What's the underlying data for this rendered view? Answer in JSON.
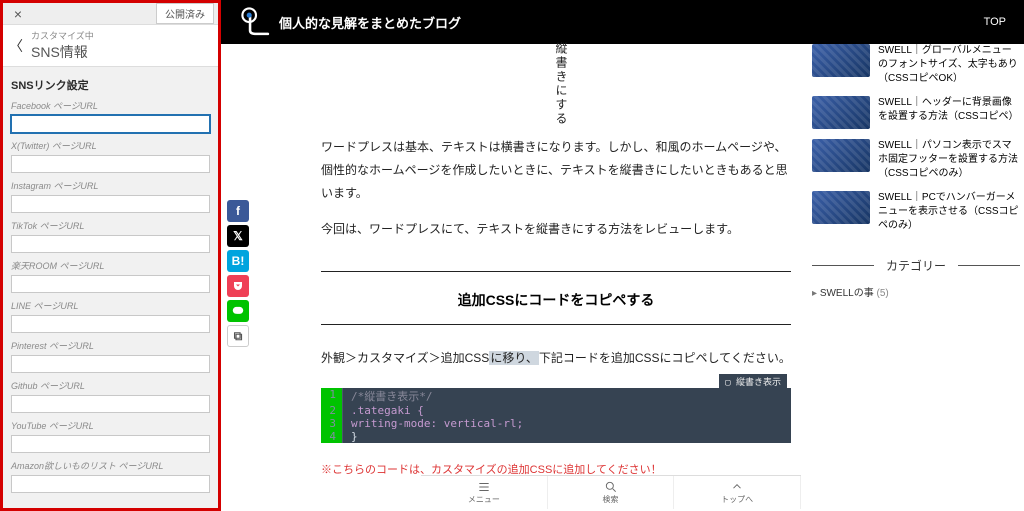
{
  "customizer": {
    "close": "×",
    "published": "公開済み",
    "breadcrumb_sub": "カスタマイズ中",
    "title": "SNS情報",
    "section": "SNSリンク設定",
    "fields": [
      {
        "label": "Facebook ページURL",
        "value": "",
        "active": true
      },
      {
        "label": "X(Twitter) ページURL",
        "value": ""
      },
      {
        "label": "Instagram ページURL",
        "value": ""
      },
      {
        "label": "TikTok ページURL",
        "value": ""
      },
      {
        "label": "楽天ROOM ページURL",
        "value": ""
      },
      {
        "label": "LINE ページURL",
        "value": ""
      },
      {
        "label": "Pinterest ページURL",
        "value": ""
      },
      {
        "label": "Github ページURL",
        "value": ""
      },
      {
        "label": "YouTube ページURL",
        "value": ""
      },
      {
        "label": "Amazon欲しいものリスト ページURL",
        "value": ""
      }
    ]
  },
  "header": {
    "site_name": "個人的な見解をまとめたブログ",
    "nav_top": "TOP"
  },
  "share_icons": {
    "fb": "f",
    "tw": "𝕏",
    "hb": "B!",
    "pk": "⯑",
    "ln": "LINE",
    "cp": "⧉"
  },
  "article": {
    "tategaki_sample": "縦書きにする",
    "p1": "ワードプレスは基本、テキストは横書きになります。しかし、和風のホームページや、個性的なホームページを作成したいときに、テキストを縦書きにしたいときもあると思います。",
    "p2": "今回は、ワードプレスにて、テキストを縦書きにする方法をレビューします。",
    "h2": "追加CSSにコードをコピペする",
    "path_pre": "外観＞カスタマイズ＞追加CSS",
    "path_hl": "に移り、",
    "path_post": "下記コードを追加CSSにコピペしてください。",
    "code_tag": "▢ 縦書き表示",
    "code": [
      {
        "n": "1",
        "kw": "",
        "txt": "/*縦書き表示*/",
        "cls": "cm"
      },
      {
        "n": "2",
        "kw": ".tategaki",
        "txt": " {",
        "cls": "kw"
      },
      {
        "n": "3",
        "kw": "writing-mode",
        "txt": ": vertical-rl;",
        "cls": "kw"
      },
      {
        "n": "4",
        "kw": "",
        "txt": "}",
        "cls": ""
      }
    ],
    "warning": "※こちらのコードは、カスタマイズの追加CSSに追加してください！"
  },
  "sidebar": {
    "cards": [
      {
        "t": "SWELL｜グローバルメニューのフォントサイズ、太字もあり（CSSコピペOK）"
      },
      {
        "t": "SWELL｜ヘッダーに背景画像を設置する方法（CSSコピペ）"
      },
      {
        "t": "SWELL｜パソコン表示でスマホ固定フッターを設置する方法（CSSコピペのみ）"
      },
      {
        "t": "SWELL｜PCでハンバーガーメニューを表示させる（CSSコピペのみ）"
      }
    ],
    "cat_heading": "カテゴリー",
    "cat_item": "SWELLの事",
    "cat_count": "(5)"
  },
  "bottom_nav": {
    "menu": "メニュー",
    "search": "検索",
    "top": "トップへ"
  }
}
